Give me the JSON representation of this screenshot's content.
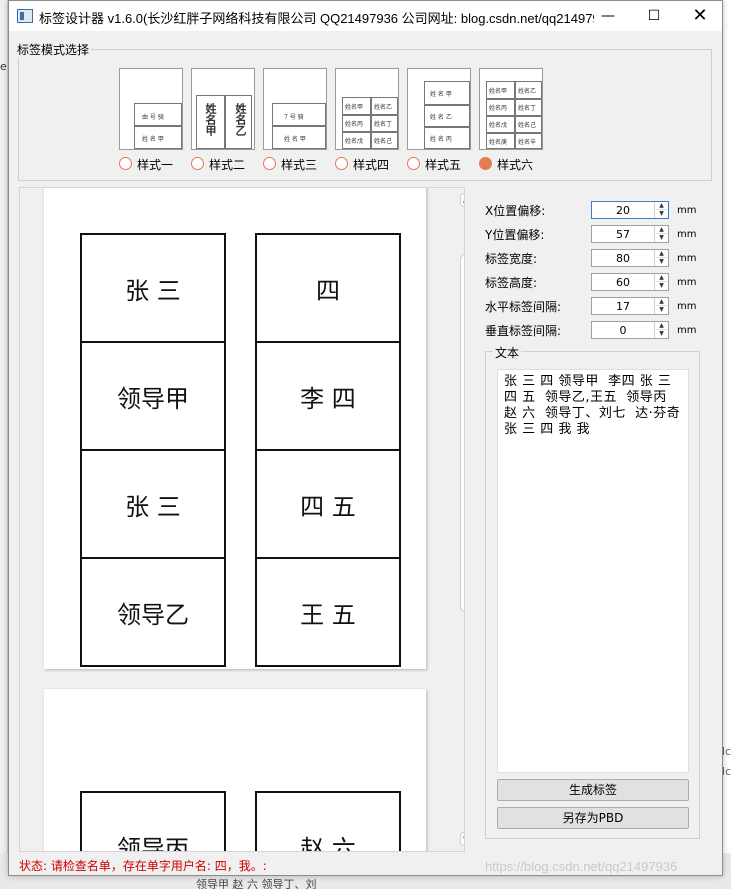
{
  "window": {
    "title": "标签设计器 v1.6.0(长沙红胖子网络科技有限公司 QQ21497936 公司网址: blog.csdn.net/qq214979...",
    "minimize_icon": "minimize-icon",
    "maximize_icon": "maximize-icon",
    "close_icon": "close-icon"
  },
  "style_group": {
    "title": "标签模式选择",
    "options": [
      {
        "label": "样式一",
        "checked": false,
        "thumb": [
          "由 号 骑",
          "姓 名 甲"
        ]
      },
      {
        "label": "样式二",
        "checked": false,
        "thumb": [
          "姓名甲",
          "姓名乙"
        ]
      },
      {
        "label": "样式三",
        "checked": false,
        "thumb": [
          "7 号 骑",
          "姓 名 甲"
        ]
      },
      {
        "label": "样式四",
        "checked": false,
        "thumb": [
          "姓名甲",
          "姓名乙",
          "姓名丙",
          "姓名丁",
          "姓名戊",
          "姓名己"
        ]
      },
      {
        "label": "样式五",
        "checked": false,
        "thumb": [
          "姓 名 甲",
          "姓 名 乙",
          "姓 名 丙"
        ]
      },
      {
        "label": "样式六",
        "checked": true,
        "thumb": [
          "姓名甲",
          "姓名乙",
          "姓名丙",
          "姓名丁",
          "姓名戊",
          "姓名己",
          "姓名庚",
          "姓名辛"
        ]
      }
    ]
  },
  "preview": {
    "page1": {
      "left_column": [
        "张  三",
        "领导甲",
        "张  三",
        "领导乙"
      ],
      "right_column": [
        "四",
        "李  四",
        "四  五",
        "王  五"
      ]
    },
    "page2": {
      "left_column": [
        "领导丙"
      ],
      "right_column": [
        "赵  六"
      ]
    }
  },
  "settings": {
    "x_offset": {
      "label": "X位置偏移:",
      "value": "20",
      "unit": "mm"
    },
    "y_offset": {
      "label": "Y位置偏移:",
      "value": "57",
      "unit": "mm"
    },
    "label_width": {
      "label": "标签宽度:",
      "value": "80",
      "unit": "mm"
    },
    "label_height": {
      "label": "标签高度:",
      "value": "60",
      "unit": "mm"
    },
    "h_spacing": {
      "label": "水平标签间隔:",
      "value": "17",
      "unit": "mm"
    },
    "v_spacing": {
      "label": "垂直标签间隔:",
      "value": "0",
      "unit": "mm"
    }
  },
  "text_group": {
    "title": "文本",
    "content": "张 三 四 领导甲  李四 张 三 四 五  领导乙,王五  领导丙 赵 六  领导丁、刘七  达·芬奇 张 三 四 我 我"
  },
  "buttons": {
    "generate": "生成标签",
    "save_as": "另存为PBD"
  },
  "status": "状态: 请检查名单，存在单字用户名: 四，我。:",
  "watermark": "https://blog.csdn.net/qq21497936",
  "background": {
    "left_letter": "e",
    "bottom_text": "领导甲 赵 六   领导丁、刘",
    "right_text": "dc\ndc"
  },
  "colors": {
    "radio_accent": "#e47e4e",
    "status_text": "#d00000",
    "focus_border": "#3c7fd1"
  }
}
